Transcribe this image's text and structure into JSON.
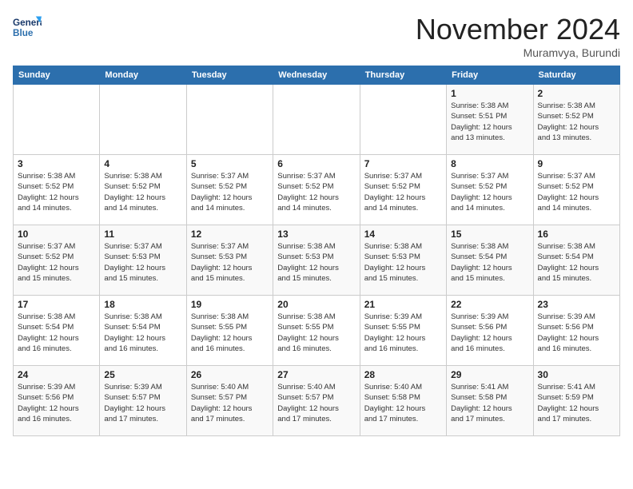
{
  "logo": {
    "line1": "General",
    "line2": "Blue"
  },
  "header": {
    "month": "November 2024",
    "location": "Muramvya, Burundi"
  },
  "weekdays": [
    "Sunday",
    "Monday",
    "Tuesday",
    "Wednesday",
    "Thursday",
    "Friday",
    "Saturday"
  ],
  "weeks": [
    [
      {
        "day": "",
        "info": ""
      },
      {
        "day": "",
        "info": ""
      },
      {
        "day": "",
        "info": ""
      },
      {
        "day": "",
        "info": ""
      },
      {
        "day": "",
        "info": ""
      },
      {
        "day": "1",
        "info": "Sunrise: 5:38 AM\nSunset: 5:51 PM\nDaylight: 12 hours\nand 13 minutes."
      },
      {
        "day": "2",
        "info": "Sunrise: 5:38 AM\nSunset: 5:52 PM\nDaylight: 12 hours\nand 13 minutes."
      }
    ],
    [
      {
        "day": "3",
        "info": "Sunrise: 5:38 AM\nSunset: 5:52 PM\nDaylight: 12 hours\nand 14 minutes."
      },
      {
        "day": "4",
        "info": "Sunrise: 5:38 AM\nSunset: 5:52 PM\nDaylight: 12 hours\nand 14 minutes."
      },
      {
        "day": "5",
        "info": "Sunrise: 5:37 AM\nSunset: 5:52 PM\nDaylight: 12 hours\nand 14 minutes."
      },
      {
        "day": "6",
        "info": "Sunrise: 5:37 AM\nSunset: 5:52 PM\nDaylight: 12 hours\nand 14 minutes."
      },
      {
        "day": "7",
        "info": "Sunrise: 5:37 AM\nSunset: 5:52 PM\nDaylight: 12 hours\nand 14 minutes."
      },
      {
        "day": "8",
        "info": "Sunrise: 5:37 AM\nSunset: 5:52 PM\nDaylight: 12 hours\nand 14 minutes."
      },
      {
        "day": "9",
        "info": "Sunrise: 5:37 AM\nSunset: 5:52 PM\nDaylight: 12 hours\nand 14 minutes."
      }
    ],
    [
      {
        "day": "10",
        "info": "Sunrise: 5:37 AM\nSunset: 5:52 PM\nDaylight: 12 hours\nand 15 minutes."
      },
      {
        "day": "11",
        "info": "Sunrise: 5:37 AM\nSunset: 5:53 PM\nDaylight: 12 hours\nand 15 minutes."
      },
      {
        "day": "12",
        "info": "Sunrise: 5:37 AM\nSunset: 5:53 PM\nDaylight: 12 hours\nand 15 minutes."
      },
      {
        "day": "13",
        "info": "Sunrise: 5:38 AM\nSunset: 5:53 PM\nDaylight: 12 hours\nand 15 minutes."
      },
      {
        "day": "14",
        "info": "Sunrise: 5:38 AM\nSunset: 5:53 PM\nDaylight: 12 hours\nand 15 minutes."
      },
      {
        "day": "15",
        "info": "Sunrise: 5:38 AM\nSunset: 5:54 PM\nDaylight: 12 hours\nand 15 minutes."
      },
      {
        "day": "16",
        "info": "Sunrise: 5:38 AM\nSunset: 5:54 PM\nDaylight: 12 hours\nand 15 minutes."
      }
    ],
    [
      {
        "day": "17",
        "info": "Sunrise: 5:38 AM\nSunset: 5:54 PM\nDaylight: 12 hours\nand 16 minutes."
      },
      {
        "day": "18",
        "info": "Sunrise: 5:38 AM\nSunset: 5:54 PM\nDaylight: 12 hours\nand 16 minutes."
      },
      {
        "day": "19",
        "info": "Sunrise: 5:38 AM\nSunset: 5:55 PM\nDaylight: 12 hours\nand 16 minutes."
      },
      {
        "day": "20",
        "info": "Sunrise: 5:38 AM\nSunset: 5:55 PM\nDaylight: 12 hours\nand 16 minutes."
      },
      {
        "day": "21",
        "info": "Sunrise: 5:39 AM\nSunset: 5:55 PM\nDaylight: 12 hours\nand 16 minutes."
      },
      {
        "day": "22",
        "info": "Sunrise: 5:39 AM\nSunset: 5:56 PM\nDaylight: 12 hours\nand 16 minutes."
      },
      {
        "day": "23",
        "info": "Sunrise: 5:39 AM\nSunset: 5:56 PM\nDaylight: 12 hours\nand 16 minutes."
      }
    ],
    [
      {
        "day": "24",
        "info": "Sunrise: 5:39 AM\nSunset: 5:56 PM\nDaylight: 12 hours\nand 16 minutes."
      },
      {
        "day": "25",
        "info": "Sunrise: 5:39 AM\nSunset: 5:57 PM\nDaylight: 12 hours\nand 17 minutes."
      },
      {
        "day": "26",
        "info": "Sunrise: 5:40 AM\nSunset: 5:57 PM\nDaylight: 12 hours\nand 17 minutes."
      },
      {
        "day": "27",
        "info": "Sunrise: 5:40 AM\nSunset: 5:57 PM\nDaylight: 12 hours\nand 17 minutes."
      },
      {
        "day": "28",
        "info": "Sunrise: 5:40 AM\nSunset: 5:58 PM\nDaylight: 12 hours\nand 17 minutes."
      },
      {
        "day": "29",
        "info": "Sunrise: 5:41 AM\nSunset: 5:58 PM\nDaylight: 12 hours\nand 17 minutes."
      },
      {
        "day": "30",
        "info": "Sunrise: 5:41 AM\nSunset: 5:59 PM\nDaylight: 12 hours\nand 17 minutes."
      }
    ]
  ]
}
